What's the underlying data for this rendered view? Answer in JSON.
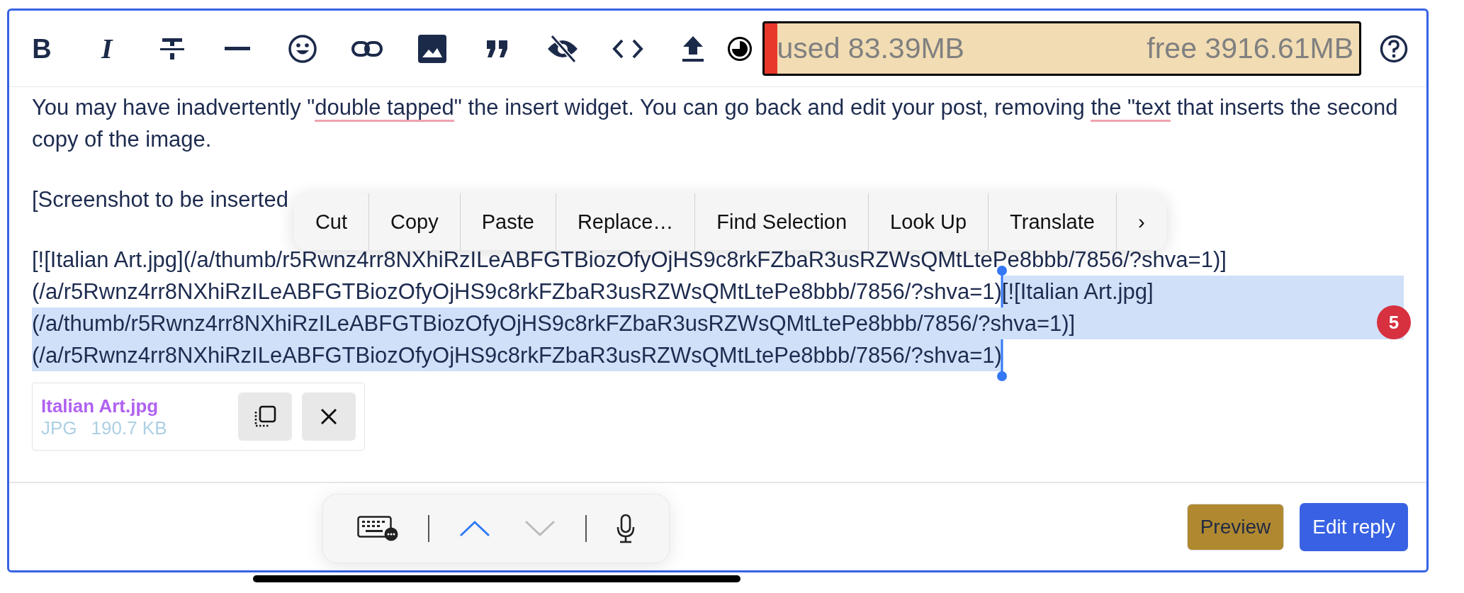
{
  "toolbar": {
    "buttons": [
      {
        "kind": "bold",
        "label": "B"
      },
      {
        "kind": "italic",
        "label": "I"
      },
      {
        "kind": "strike"
      },
      {
        "kind": "rule"
      },
      {
        "kind": "emoji"
      },
      {
        "kind": "link"
      },
      {
        "kind": "image"
      },
      {
        "kind": "quote"
      },
      {
        "kind": "hide"
      },
      {
        "kind": "code"
      },
      {
        "kind": "upload"
      },
      {
        "kind": "theme"
      }
    ],
    "memory": {
      "used": "used 83.39MB",
      "free": "free 3916.61MB",
      "level": 0.021
    }
  },
  "editor": {
    "paragraphs": [
      {
        "kind": "prose",
        "segments": [
          {
            "text": "You may have inadvertently \"",
            "misspelled": false
          },
          {
            "text": "double tapped",
            "misspelled": true
          },
          {
            "text": "\" the insert widget. You can go back and edit your post, removing ",
            "misspelled": false
          },
          {
            "text": "the \"text",
            "misspelled": true
          },
          {
            "text": " that inserts the second copy of the image.",
            "misspelled": false
          }
        ]
      },
      {
        "kind": "prose",
        "segments": [
          {
            "text": "[Screenshot to be inserted",
            "misspelled": false
          }
        ]
      },
      {
        "kind": "markdown",
        "lines": [
          {
            "segments": [
              {
                "text": "[![Italian Art.jpg](/a/thumb/r5Rwnz4rr8NXhiRzILeABFGTBiozOfyOjHS9c8rkFZbaR3usRZWsQMtLtePe8bbb/7856/?shva=1)]",
                "selected": false
              }
            ]
          },
          {
            "segments": [
              {
                "text": "(/a/r5Rwnz4rr8NXhiRzILeABFGTBiozOfyOjHS9c8rkFZbaR3usRZWsQMtLtePe8bbb/7856/?shva=1)",
                "selected": false
              },
              {
                "text": "[![Italian Art.jpg]",
                "selected": true
              }
            ]
          },
          {
            "segments": [
              {
                "text": "(/a/thumb/r5Rwnz4rr8NXhiRzILeABFGTBiozOfyOjHS9c8rkFZbaR3usRZWsQMtLtePe8bbb/7856/?shva=1)]",
                "selected": true
              }
            ]
          },
          {
            "segments": [
              {
                "text": "(/a/r5Rwnz4rr8NXhiRzILeABFGTBiozOfyOjHS9c8rkFZbaR3usRZWsQMtLtePe8bbb/7856/?shva=1)",
                "selected": true
              }
            ]
          }
        ]
      }
    ],
    "badge": "5",
    "attachment": {
      "name": "Italian Art.jpg",
      "type": "JPG",
      "size": "190.7 KB"
    }
  },
  "context_menu": {
    "items": [
      "Cut",
      "Copy",
      "Paste",
      "Replace…",
      "Find Selection",
      "Look Up",
      "Translate",
      "›"
    ]
  },
  "keyboard_bar": {
    "items": [
      {
        "kind": "keyboard"
      },
      {
        "kind": "up",
        "disabled": false
      },
      {
        "kind": "down",
        "disabled": true
      },
      {
        "kind": "mic"
      }
    ]
  },
  "buttons": [
    {
      "kind": "preview",
      "label": "Preview"
    },
    {
      "kind": "primary",
      "label": "Edit reply"
    }
  ]
}
